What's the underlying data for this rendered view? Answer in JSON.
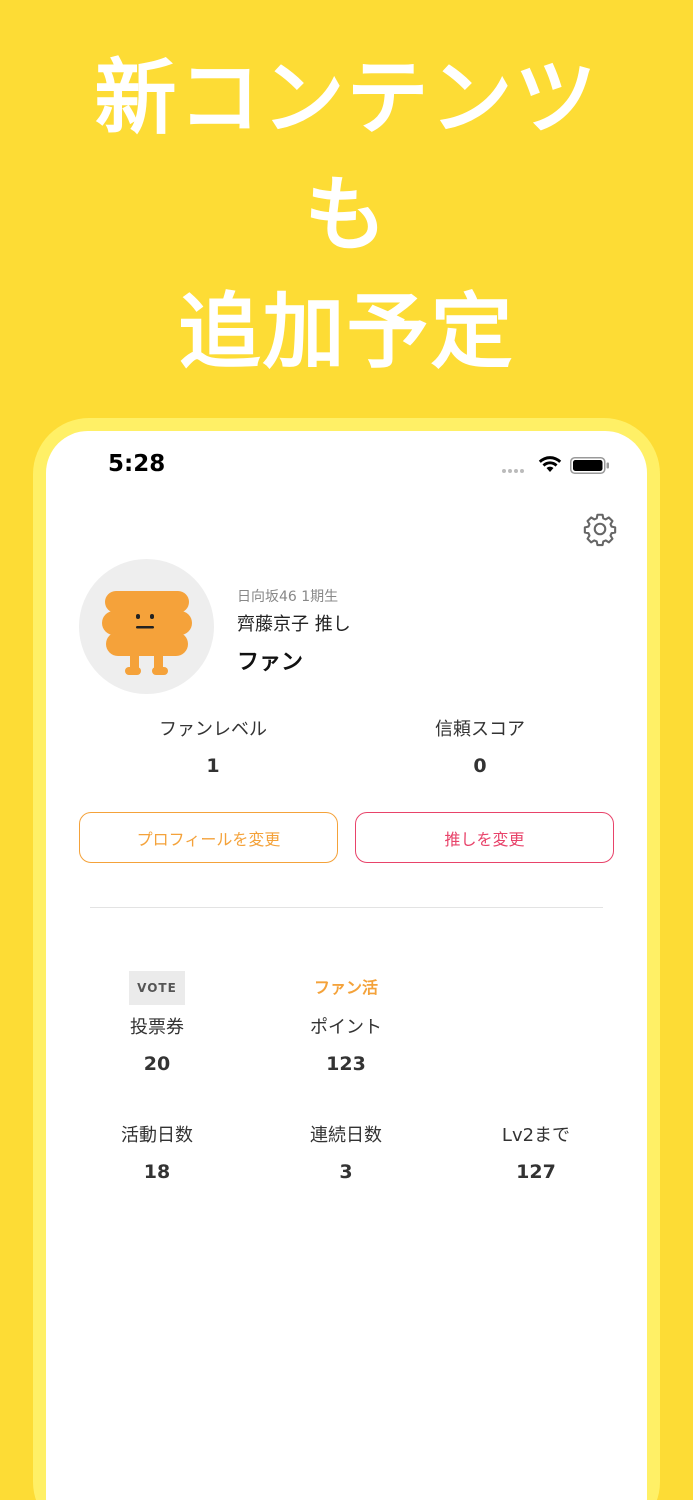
{
  "headline": {
    "line1": "新コンテンツ",
    "line2": "も",
    "line3": "追加予定"
  },
  "status_bar": {
    "time": "5:28"
  },
  "profile": {
    "group": "日向坂46 1期生",
    "oshi": "齊藤京子 推し",
    "rank": "ファン"
  },
  "stats_top": [
    {
      "label": "ファンレベル",
      "value": "1"
    },
    {
      "label": "信頼スコア",
      "value": "0"
    }
  ],
  "buttons": {
    "change_profile": "プロフィールを変更",
    "change_oshi": "推しを変更"
  },
  "tickets": {
    "vote_badge": "VOTE",
    "vote_label": "投票券",
    "vote_value": "20",
    "fankatsu_badge": "ファン活",
    "points_label": "ポイント",
    "points_value": "123"
  },
  "activity": [
    {
      "label": "活動日数",
      "value": "18"
    },
    {
      "label": "連続日数",
      "value": "3"
    },
    {
      "label": "Lv2まで",
      "value": "127"
    }
  ],
  "colors": {
    "background": "#FDDC35",
    "orange_accent": "#F4A23A",
    "pink_accent": "#E8436A"
  },
  "icons": [
    "wifi-icon",
    "battery-icon",
    "gear-icon",
    "character-avatar"
  ]
}
